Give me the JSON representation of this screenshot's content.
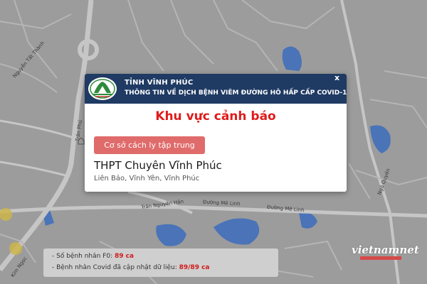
{
  "colors": {
    "map_background": "#9c9c9c",
    "road": "#c6c6c6",
    "water": "#4a73b8",
    "header_background": "#1f3a63",
    "alert_title": "#e01b1b",
    "category_tag": "#e06b6b",
    "stat_value": "#d21a1a"
  },
  "map": {
    "street_labels": [
      "Đường Mê Linh",
      "Đường Mê Linh",
      "Trần Nguyên Hãn",
      "Trần Phú",
      "Nguyễn Tất Thành",
      "Ngô Quyền",
      "Kim Ngọc"
    ]
  },
  "popup": {
    "logo": "vinh-phuc-emblem-icon",
    "header_line1": "TỈNH VĨNH PHÚC",
    "header_line2": "THÔNG TIN VỀ DỊCH BỆNH VIÊM ĐƯỜNG HÔ HẤP CẤP COVID-19",
    "close_label": "x",
    "alert_title": "Khu vực cảnh báo",
    "category": "Cơ sở cách ly tập trung",
    "place_name": "THPT Chuyên Vĩnh Phúc",
    "address": "Liên Bảo, Vĩnh Yên, Vĩnh Phúc"
  },
  "stats": {
    "f0_label": "- Số bệnh nhân F0: ",
    "f0_value": "89 ca",
    "updated_label": "- Bệnh nhân Covid đã cập nhật dữ liệu: ",
    "updated_value": "89/89 ca"
  },
  "watermark": {
    "text": "vietnamnet"
  }
}
